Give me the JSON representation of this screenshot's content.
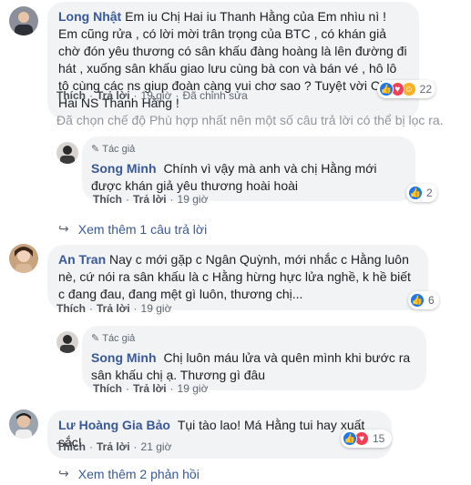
{
  "comments": [
    {
      "author": "Long Nhật",
      "text": "Em iu Chị Hai iu Thanh Hằng của Em nhìu nì ! Em cũng rửa , có lời mời trân trọng của BTC , có khán giả chờ đón yêu thương có sân khấu đàng hoàng là lên đường đi hát , xuống sân khấu giao lưu cùng bà con và bán vé , hô lô tô cùng các ns giup đoàn càng vui chơ sao ? Tuyệt vời Chị Hai NS Thanh Hằng !",
      "like": "Thích",
      "reply": "Trả lời",
      "time": "19 giờ",
      "edited": "Đã chỉnh sửa",
      "reaction_count": "22"
    },
    {
      "author": "An Tran",
      "text": "Nay c mới gặp c Ngân Quỳnh, mới nhắc c Hằng luôn nè, cứ nói ra sân khấu là c Hằng hừng hực lửa nghề, k hề biết c đang đau, đang mệt gì luôn, thương chị...",
      "like": "Thích",
      "reply": "Trả lời",
      "time": "19 giờ",
      "reaction_count": "6"
    },
    {
      "author": "Lư Hoàng Gia Bảo",
      "text": "Tụi tào lao! Má Hằng tui hay xuất sắc!",
      "like": "Thích",
      "reply": "Trả lời",
      "time": "21 giờ",
      "reaction_count": "15"
    }
  ],
  "filter_note": "Đã chọn chế độ Phù hợp nhất nên một số câu trả lời có thể bị lọc ra.",
  "replies": [
    {
      "badge": "Tác giả",
      "author": "Song Minh",
      "text": "Chính vì vậy mà anh và chị Hằng mới được khán giả yêu thương hoài hoài",
      "like": "Thích",
      "reply": "Trả lời",
      "time": "19 giờ",
      "reaction_count": "2"
    },
    {
      "badge": "Tác giả",
      "author": "Song Minh",
      "text": "Chị luôn máu lửa và quên mình khi bước ra sân khấu chị ạ. Thương gì đâu",
      "like": "Thích",
      "reply": "Trả lời",
      "time": "19 giờ"
    }
  ],
  "see_more_1": "Xem thêm 1 câu trả lời",
  "see_more_2": "Xem thêm 2 phản hồi",
  "colors": {
    "link": "#385898",
    "bubble": "#f2f3f5",
    "like_blue": "#1877f2",
    "love_red": "#f33e58",
    "haha_yellow": "#f7b125"
  }
}
